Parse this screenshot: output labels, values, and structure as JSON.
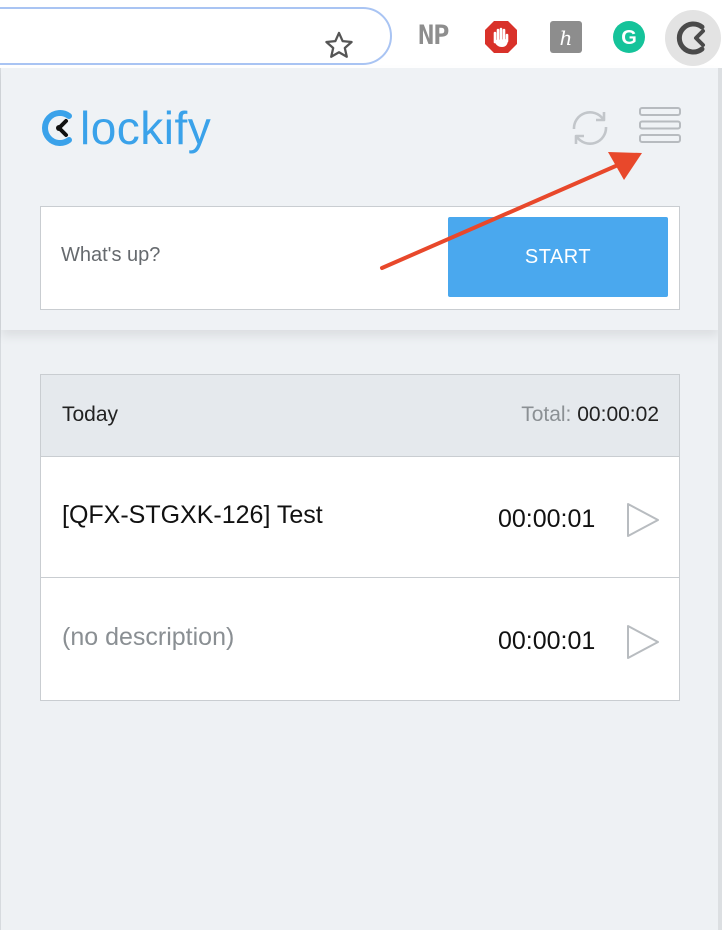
{
  "browser": {
    "extensions": [
      {
        "name": "np-extension",
        "label": "NP"
      },
      {
        "name": "adblock-icon"
      },
      {
        "name": "honey-extension-icon",
        "glyph": "h"
      },
      {
        "name": "grammarly-icon",
        "glyph": "G"
      },
      {
        "name": "clockify-extension-icon"
      }
    ]
  },
  "header": {
    "logo_text": "lockify",
    "brand_color": "#3aa2ea"
  },
  "entry": {
    "placeholder": "What's up?",
    "start_label": "START",
    "button_color": "#4aa8ee"
  },
  "list": {
    "group_label": "Today",
    "total_label": "Total:",
    "total_value": "00:00:02",
    "entries": [
      {
        "description": "[QFX-STGXK-126] Test",
        "duration": "00:00:01"
      },
      {
        "description": "(no description)",
        "duration": "00:00:01"
      }
    ]
  },
  "annotation": {
    "arrow_color": "#e8482b"
  }
}
